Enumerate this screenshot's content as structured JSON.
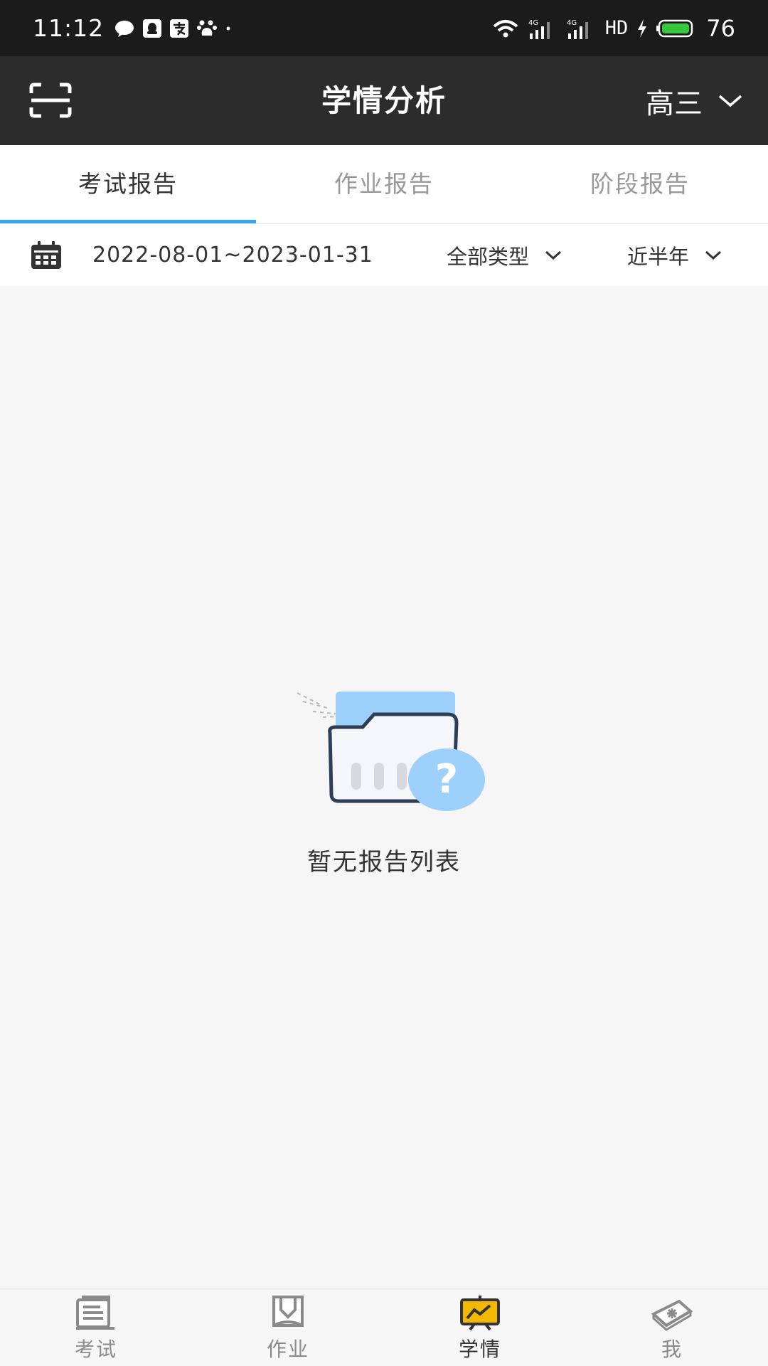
{
  "status_bar": {
    "time": "11:12",
    "network_label": "HD",
    "signal_1": "4G",
    "signal_2": "4G",
    "battery_percent": "76",
    "battery_color": "#36c93b"
  },
  "header": {
    "title": "学情分析",
    "grade": "高三"
  },
  "tabs": [
    {
      "label": "考试报告",
      "active": true
    },
    {
      "label": "作业报告",
      "active": false
    },
    {
      "label": "阶段报告",
      "active": false
    }
  ],
  "filter": {
    "date_range": "2022-08-01~2023-01-31",
    "type": "全部类型",
    "period": "近半年"
  },
  "empty_state": {
    "message": "暂无报告列表"
  },
  "bottom_nav": [
    {
      "label": "考试",
      "icon": "exam-icon",
      "active": false
    },
    {
      "label": "作业",
      "icon": "homework-icon",
      "active": false
    },
    {
      "label": "学情",
      "icon": "analysis-icon",
      "active": true
    },
    {
      "label": "我",
      "icon": "profile-icon",
      "active": false
    }
  ],
  "colors": {
    "accent": "#35a9f0",
    "header_bg": "#2c2c2c",
    "nav_active_icon": "#f5b800"
  }
}
